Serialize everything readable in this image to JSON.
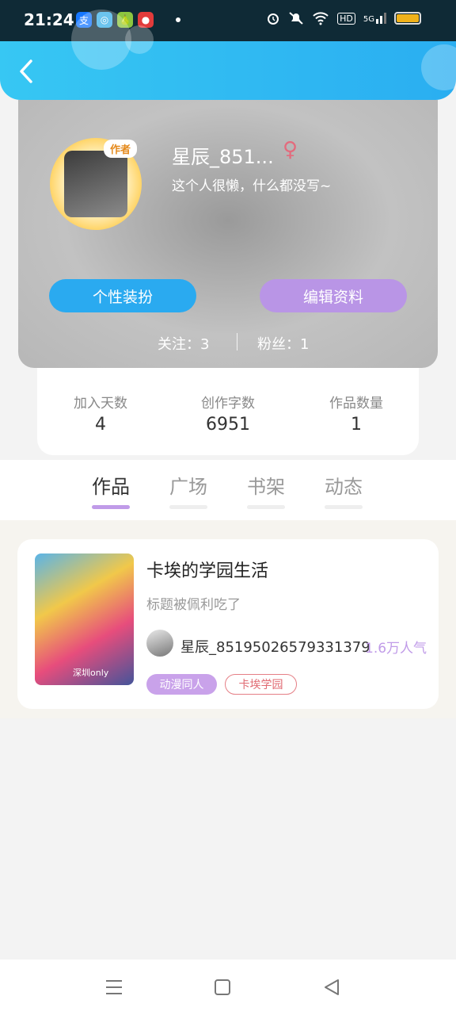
{
  "status_bar": {
    "time": "21:24",
    "app_icons": [
      {
        "name": "alipay-icon",
        "glyph": "支",
        "color": "#1677ff"
      },
      {
        "name": "browser-icon",
        "glyph": "◎",
        "color": "#3bb0e8"
      },
      {
        "name": "pear-icon",
        "glyph": "🍐",
        "color": "#8cc63f"
      },
      {
        "name": "app-red-icon",
        "glyph": "●",
        "color": "#e23b3b"
      }
    ],
    "network": "HD",
    "signal_label": "5G"
  },
  "profile": {
    "author_badge": "作者",
    "username": "星辰_851...",
    "gender_symbol": "♀",
    "bio": "这个人很懒，什么都没写~",
    "dress_button": "个性装扮",
    "edit_button": "编辑资料",
    "following": "关注：3",
    "followers": "粉丝：1"
  },
  "stats": [
    {
      "label": "加入天数",
      "value": "4"
    },
    {
      "label": "创作字数",
      "value": "6951"
    },
    {
      "label": "作品数量",
      "value": "1"
    }
  ],
  "tabs": [
    {
      "label": "作品",
      "active": true
    },
    {
      "label": "广场",
      "active": false
    },
    {
      "label": "书架",
      "active": false
    },
    {
      "label": "动态",
      "active": false
    }
  ],
  "works": [
    {
      "cover_text": "深圳only",
      "title": "卡埃的学园生活",
      "description": "标题被佩利吃了",
      "author": "星辰_85195026579331379",
      "popularity": "1.6万人气",
      "tags": [
        "动漫同人",
        "卡埃学园"
      ]
    }
  ],
  "colors": {
    "header": "#2aaef1",
    "accent_blue": "#2aaaf0",
    "accent_purple": "#b995e6",
    "gender": "#e36b7d"
  }
}
